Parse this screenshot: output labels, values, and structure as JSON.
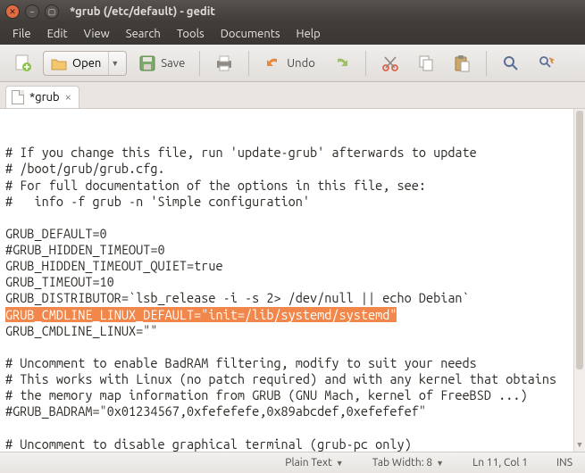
{
  "window": {
    "title": "*grub (/etc/default) - gedit"
  },
  "menubar": [
    "File",
    "Edit",
    "View",
    "Search",
    "Tools",
    "Documents",
    "Help"
  ],
  "toolbar": {
    "open_label": "Open",
    "save_label": "Save",
    "undo_label": "Undo"
  },
  "tabs": [
    {
      "label": "*grub"
    }
  ],
  "editor": {
    "lines": [
      "# If you change this file, run 'update-grub' afterwards to update",
      "# /boot/grub/grub.cfg.",
      "# For full documentation of the options in this file, see:",
      "#   info -f grub -n 'Simple configuration'",
      "",
      "GRUB_DEFAULT=0",
      "#GRUB_HIDDEN_TIMEOUT=0",
      "GRUB_HIDDEN_TIMEOUT_QUIET=true",
      "GRUB_TIMEOUT=10",
      "GRUB_DISTRIBUTOR=`lsb_release -i -s 2> /dev/null || echo Debian`",
      "GRUB_CMDLINE_LINUX_DEFAULT=\"init=/lib/systemd/systemd\"",
      "GRUB_CMDLINE_LINUX=\"\"",
      "",
      "# Uncomment to enable BadRAM filtering, modify to suit your needs",
      "# This works with Linux (no patch required) and with any kernel that obtains",
      "# the memory map information from GRUB (GNU Mach, kernel of FreeBSD ...)",
      "#GRUB_BADRAM=\"0x01234567,0xfefefefe,0x89abcdef,0xefefefef\"",
      "",
      "# Uncomment to disable graphical terminal (grub-pc only)"
    ],
    "highlighted_line_index": 10
  },
  "statusbar": {
    "syntax": "Plain Text",
    "tab_width": "Tab Width: 8",
    "position": "Ln 11, Col 1",
    "insert_mode": "INS"
  }
}
